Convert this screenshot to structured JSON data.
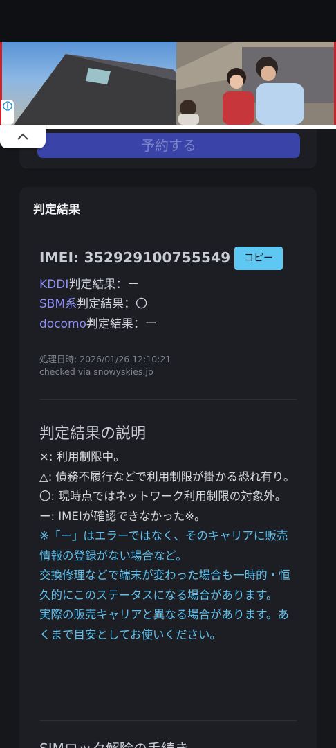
{
  "top_card": {
    "button_label": "予約する"
  },
  "result": {
    "title": "判定結果",
    "imei_label": "IMEI: 352929100755549",
    "copy_label": "コピー",
    "carriers": [
      {
        "name": "KDDI",
        "suffix": "判定結果：ー"
      },
      {
        "name": "SBM系",
        "suffix": "判定結果：〇"
      },
      {
        "name": "docomo",
        "suffix": "判定結果：ー"
      }
    ],
    "processed_at": "処理日時: 2026/01/26 12:10:21",
    "checked_via": "checked via snowyskies.jp"
  },
  "explanation": {
    "title": "判定結果の説明",
    "lines": [
      "×: 利用制限中。",
      "△: 債務不履行などで利用制限が掛かる恐れ有り。",
      "〇: 現時点ではネットワーク利用制限の対象外。",
      "ー: IMEIが確認できなかった※。"
    ],
    "notes": [
      "※「ー」はエラーではなく、そのキャリアに販売情報の登録がない場合など。",
      "交換修理などで端末が変わった場合も一時的・恒久的にこのステータスになる場合があります。",
      "実際の販売キャリアと異なる場合があります。あくまで目安としてお使いください。"
    ]
  },
  "next_section": {
    "title": "SIMロック解除の手続き"
  },
  "colors": {
    "accent_link": "#8e90f5",
    "note_text": "#5ec0ee",
    "copy_button": "#5ec8f2",
    "reserve_button": "#3a44a8"
  }
}
